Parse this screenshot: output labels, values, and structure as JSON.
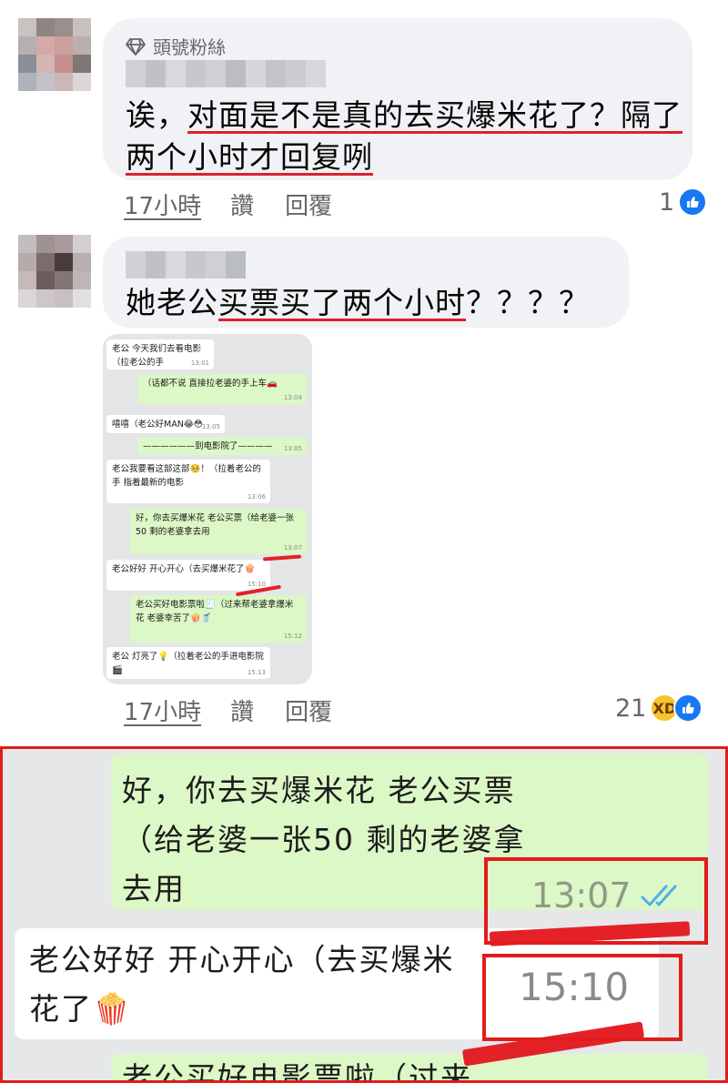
{
  "comments": [
    {
      "badge": "頭號粉絲",
      "text_plain": "诶，",
      "text_underlined": "对面是不是真的去买爆米花了？隔了两个小时才回复咧",
      "time": "17小時",
      "like": "讚",
      "reply": "回覆",
      "reaction_count": "1"
    },
    {
      "text_plain": "她老公",
      "text_underlined": "买票买了两个小时",
      "text_tail": "？？？？",
      "time": "17小時",
      "like": "讚",
      "reply": "回覆",
      "reaction_count": "21"
    }
  ],
  "chat": [
    {
      "dir": "in",
      "text": "老公 今天我们去看电影（拉老公的手",
      "time": "13:01"
    },
    {
      "dir": "out",
      "text": "（话都不说 直接拉老婆的手上车🚗",
      "time": "13:04"
    },
    {
      "dir": "in",
      "text": "嘻嘻（老公好MAN😂😳",
      "time": "13:05"
    },
    {
      "dir": "out",
      "text": "——————到电影院了————",
      "time": "13:05"
    },
    {
      "dir": "in",
      "text": "老公我要看这部这部🥺！（拉着老公的手 指着最新的电影",
      "time": "13:06"
    },
    {
      "dir": "out",
      "text": "好，你去买爆米花 老公买票（给老婆一张50 剩的老婆拿去用",
      "time": "13:07"
    },
    {
      "dir": "in",
      "text": "老公好好 开心开心（去买爆米花了🍿",
      "time": "15:10"
    },
    {
      "dir": "out",
      "text": "老公买好电影票啦🧾（过来帮老婆拿爆米花 老婆幸苦了🍿🥤",
      "time": "15:12"
    },
    {
      "dir": "in",
      "text": "老公 灯亮了💡（拉着老公的手进电影院🎬",
      "time": "15:13"
    }
  ],
  "zoom": {
    "out_text": "好，你去买爆米花 老公买票（给老婆一张50 剩的老婆拿去用",
    "out_time": "13:07",
    "in_text": "老公好好 开心开心（去买爆米花了🍿",
    "in_time": "15:10",
    "partial_text": "老公买好电影票啦（过来"
  },
  "colors": {
    "annotation_red": "#e21b1b",
    "bubble_gray": "#f0f2f5",
    "chat_green": "#dcf8c6",
    "like_blue": "#1877f2"
  },
  "icons": [
    "diamond-icon",
    "like-icon",
    "haha-icon",
    "double-check-icon"
  ]
}
